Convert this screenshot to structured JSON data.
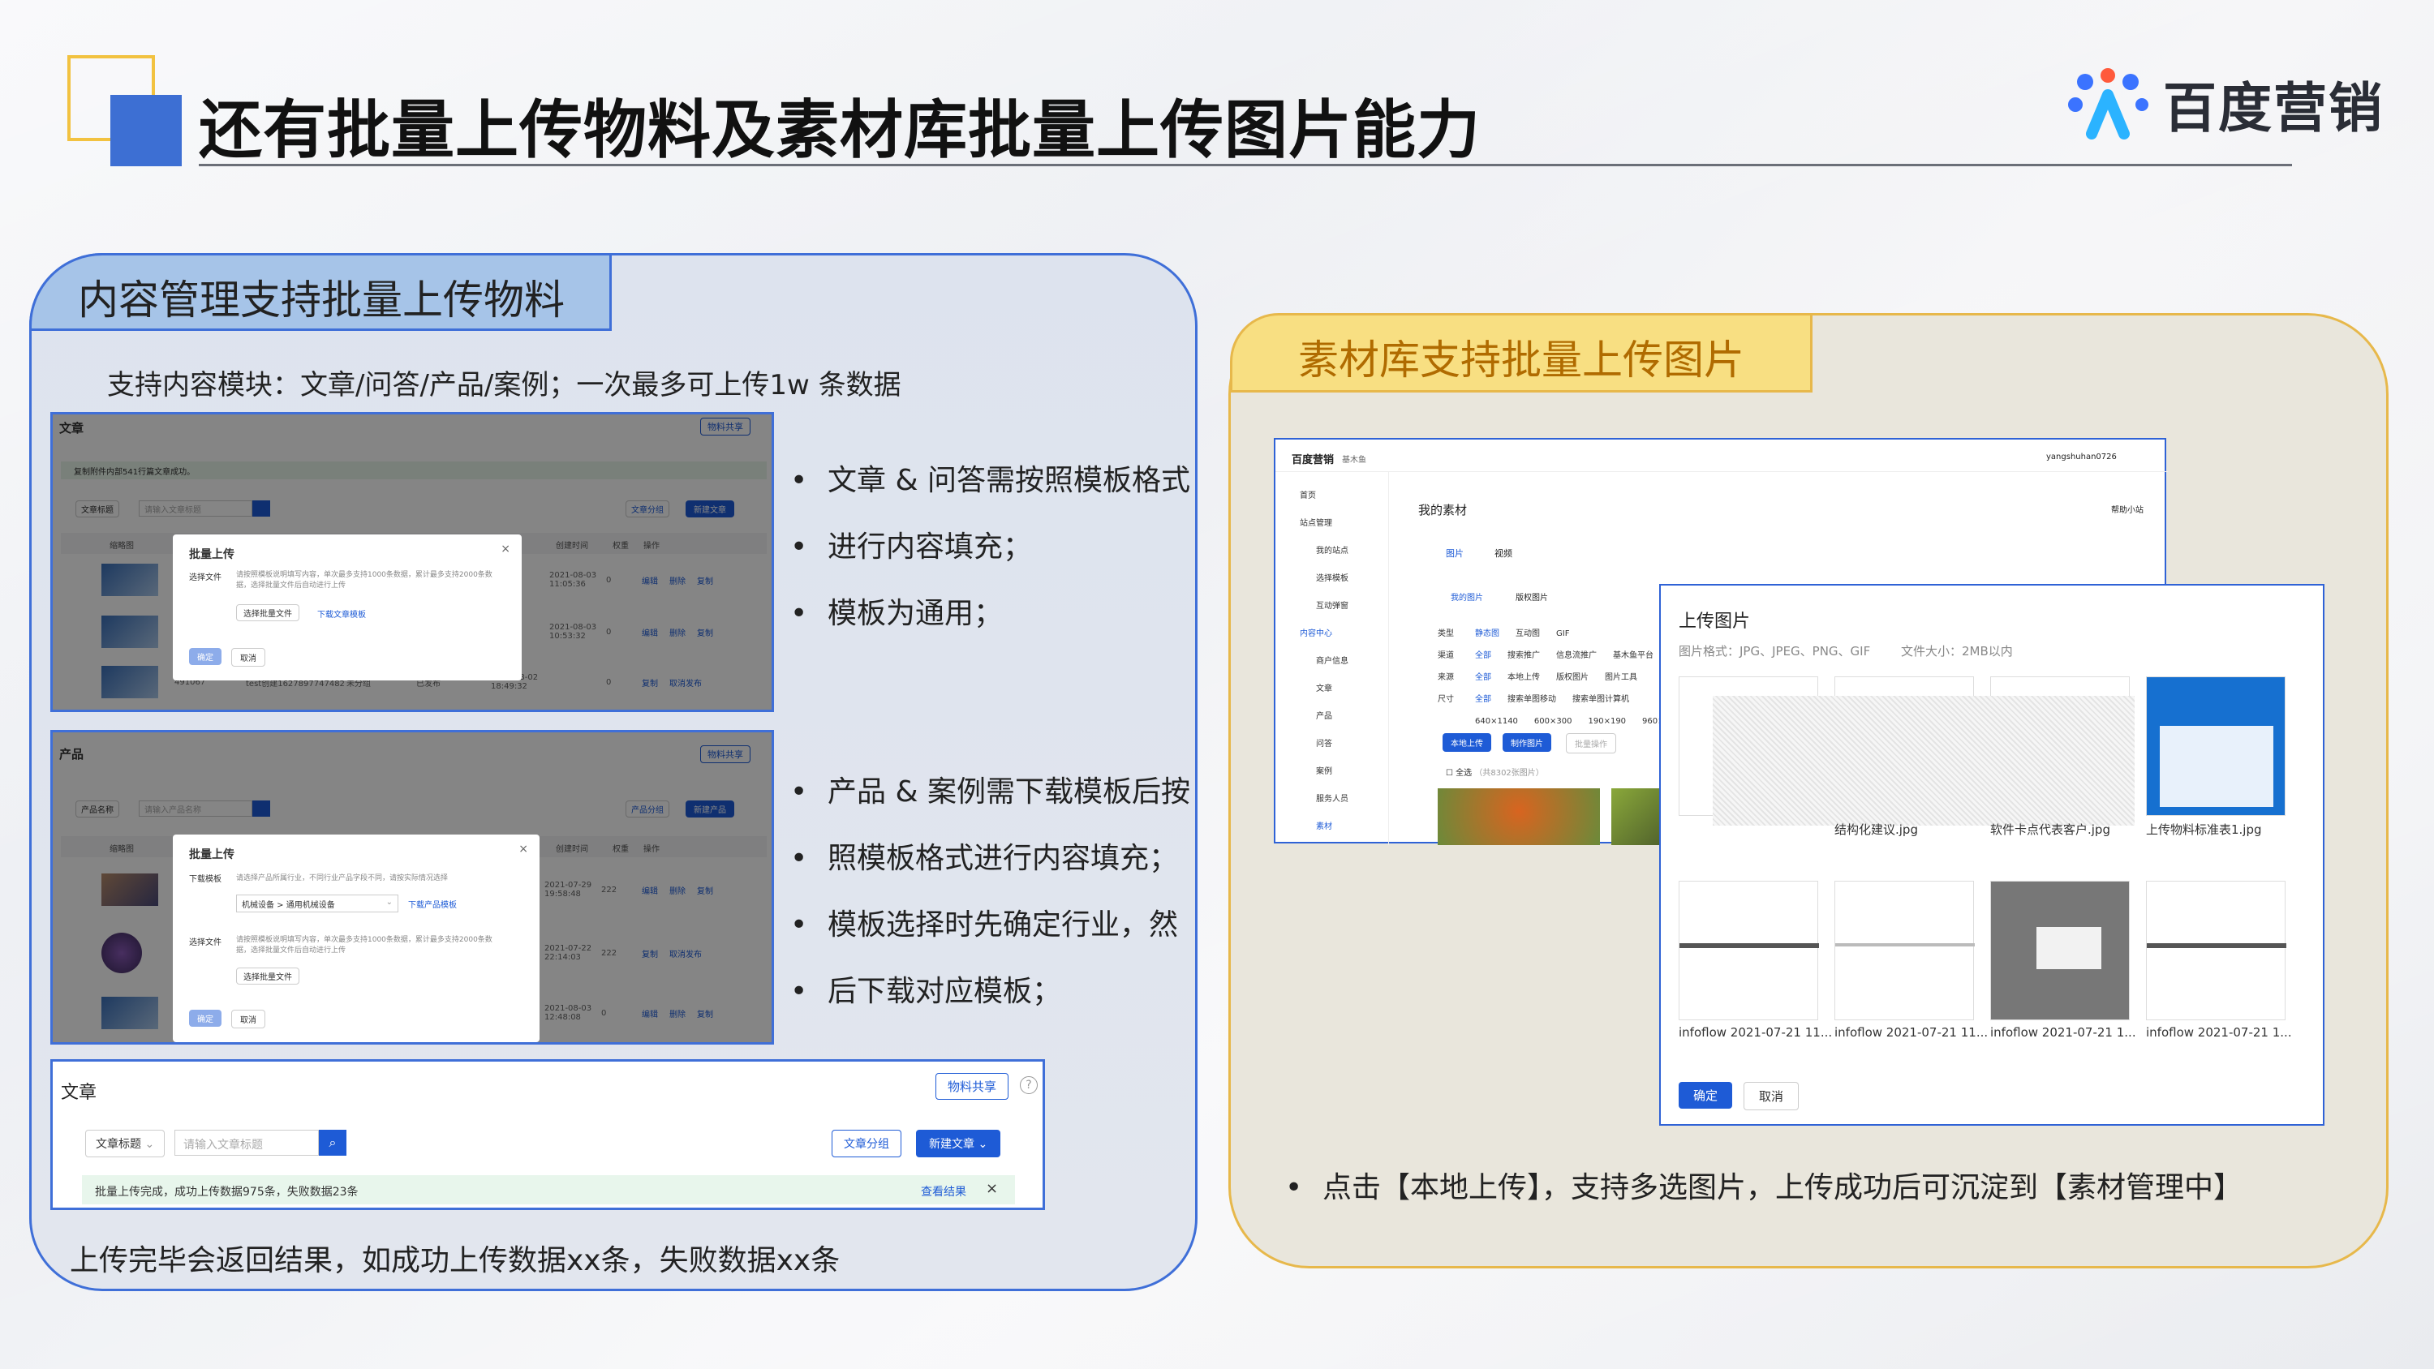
{
  "slide": {
    "title": "还有批量上传物料及素材库批量上传图片能力",
    "logo_text": "百度营销"
  },
  "left_panel": {
    "heading": "内容管理支持批量上传物料",
    "subtitle": "支持内容模块：文章/问答/产品/案例；一次最多可上传1w 条数据",
    "footer": "上传完毕会返回结果，如成功上传数据xx条，失败数据xx条",
    "bullets_top": [
      "文章 & 问答需按照模板格式",
      "进行内容填充；",
      "模板为通用；"
    ],
    "bullets_bottom": [
      "产品 & 案例需下载模板后按",
      "照模板格式进行内容填充；",
      "模板选择时先确定行业，然",
      "后下载对应模板；"
    ],
    "shot1": {
      "page": "文章",
      "share": "物料共享",
      "notice": "复制附件内部541行篇文章成功。",
      "filter": "文章标题",
      "search_ph": "请输入文章标题",
      "group": "文章分组",
      "new": "新建文章",
      "cols": [
        "缩略图",
        "创建时间",
        "权重",
        "操作"
      ],
      "modal": {
        "title": "批量上传",
        "label": "选择文件",
        "desc": "请按照模板说明填写内容，单次最多支持1000条数据，累计最多支持2000条数据，选择批量文件后自动进行上传",
        "choose": "选择批量文件",
        "download": "下载文章模板",
        "ok": "确定",
        "cancel": "取消"
      },
      "rows": [
        {
          "time": "2021-08-03 11:05:36",
          "w": "0",
          "ops": [
            "编辑",
            "删除",
            "复制"
          ]
        },
        {
          "time": "2021-08-03 10:53:32",
          "w": "0",
          "ops": [
            "编辑",
            "删除",
            "复制"
          ]
        },
        {
          "id": "491067",
          "name": "test创建1627897747482",
          "g": "未分组",
          "s": "已发布",
          "time": "2021-08-02 18:49:32",
          "w": "0",
          "ops": [
            "复制",
            "取消发布"
          ]
        }
      ]
    },
    "shot2": {
      "page": "产品",
      "share": "物料共享",
      "filter": "产品名称",
      "search_ph": "请输入产品名称",
      "group": "产品分组",
      "new": "新建产品",
      "cols": [
        "缩略图",
        "创建时间",
        "权重",
        "操作"
      ],
      "modal": {
        "title": "批量上传",
        "label1": "下载模板",
        "desc1": "请选择产品所属行业，不同行业产品字段不同，请按实际情况选择",
        "industry": "机械设备 > 通用机械设备",
        "download": "下载产品模板",
        "label2": "选择文件",
        "desc2": "请按照模板说明填写内容，单次最多支持1000条数据，累计最多支持2000条数据，选择批量文件后自动进行上传",
        "choose": "选择批量文件",
        "ok": "确定",
        "cancel": "取消"
      },
      "rows": [
        {
          "time": "2021-07-29 19:58:48",
          "w": "222",
          "ops": [
            "编辑",
            "删除",
            "复制"
          ]
        },
        {
          "time": "2021-07-22 22:14:03",
          "w": "222",
          "ops": [
            "复制",
            "取消发布"
          ]
        },
        {
          "time": "2021-08-03 12:48:08",
          "w": "0",
          "ops": [
            "编辑",
            "删除",
            "复制"
          ]
        }
      ]
    },
    "shot3": {
      "page": "文章",
      "share": "物料共享",
      "filter": "文章标题",
      "search_ph": "请输入文章标题",
      "group": "文章分组",
      "new": "新建文章",
      "result": "批量上传完成，成功上传数据975条，失败数据23条",
      "view": "查看结果"
    }
  },
  "right_panel": {
    "heading": "素材库支持批量上传图片",
    "bullet": "点击【本地上传】，支持多选图片，上传成功后可沉淀到【素材管理中】",
    "win1": {
      "brand": "百度营销",
      "brand_sub": "基木鱼",
      "user": "yangshuhan0726",
      "page_title": "我的素材",
      "help": "帮助小站",
      "nav": [
        "首页",
        "站点管理",
        "我的站点",
        "选择模板",
        "互动弹窗",
        "内容中心",
        "商户信息",
        "文章",
        "产品",
        "问答",
        "案例",
        "服务人员",
        "素材"
      ],
      "tabs": [
        "图片",
        "视频"
      ],
      "subtabs": [
        "我的图片",
        "版权图片"
      ],
      "filters": [
        {
          "k": "类型",
          "v": [
            "静态图",
            "互动图",
            "GIF"
          ]
        },
        {
          "k": "渠道",
          "v": [
            "全部",
            "搜索推广",
            "信息流推广",
            "基木鱼平台"
          ]
        },
        {
          "k": "来源",
          "v": [
            "全部",
            "本地上传",
            "版权图片",
            "图片工具"
          ]
        },
        {
          "k": "尺寸",
          "v": [
            "全部",
            "搜索单图移动",
            "搜索单图计算机"
          ]
        }
      ],
      "sizes": [
        "640×1140",
        "600×300",
        "190×190",
        "960×"
      ],
      "actions": [
        "本地上传",
        "制作图片",
        "批量操作"
      ],
      "select_all": "全选",
      "count": "（共8302张图片）"
    },
    "win2": {
      "title": "上传图片",
      "format": "图片格式：JPG、JPEG、PNG、GIF",
      "size": "文件大小：2MB以内",
      "files": [
        "结构化建议.jpg",
        "软件卡点代表客户.jpg",
        "上传物料标准表1.jpg",
        "infoflow 2021-07-21 11...",
        "infoflow 2021-07-21 11...",
        "infoflow 2021-07-21 1...",
        "infoflow 2021-07-21 1..."
      ],
      "ok": "确定",
      "cancel": "取消"
    }
  },
  "colors": {
    "blue": "#3f6fd8",
    "gold": "#e7b84b",
    "tab_blue": "#a6c4e8",
    "tab_gold": "#f8df82",
    "ui_blue": "#1e5bd6"
  }
}
